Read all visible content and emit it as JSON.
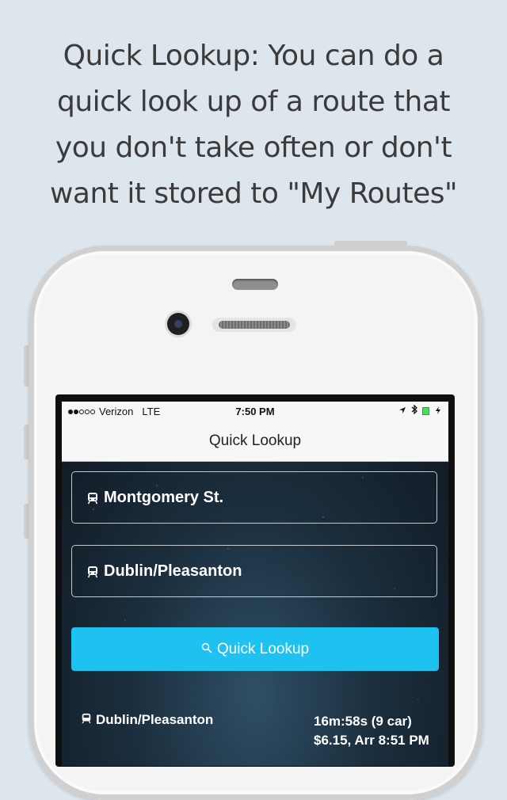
{
  "headline": {
    "lines": [
      "Quick Lookup: You can do a",
      "quick look up of a route that",
      "you don't take often or don't",
      "want it stored to \"My Routes\""
    ]
  },
  "status_bar": {
    "carrier": "Verizon",
    "network": "LTE",
    "time": "7:50 PM",
    "signal_bars_filled": 2,
    "signal_bars_total": 5
  },
  "nav": {
    "title": "Quick Lookup"
  },
  "form": {
    "origin_station": "Montgomery St.",
    "destination_station": "Dublin/Pleasanton",
    "lookup_button_label": "Quick Lookup"
  },
  "result": {
    "station": "Dublin/Pleasanton",
    "departure": "16m:58s (9 car)",
    "fare_arrival": "$6.15, Arr 8:51 PM"
  },
  "colors": {
    "background": "#dce6ec",
    "accent_button": "#1ec2f0",
    "headline_text": "#3b3b3b"
  },
  "icons": [
    "train-icon",
    "search-icon",
    "location-arrow-icon",
    "bluetooth-icon",
    "battery-icon",
    "charging-icon"
  ]
}
